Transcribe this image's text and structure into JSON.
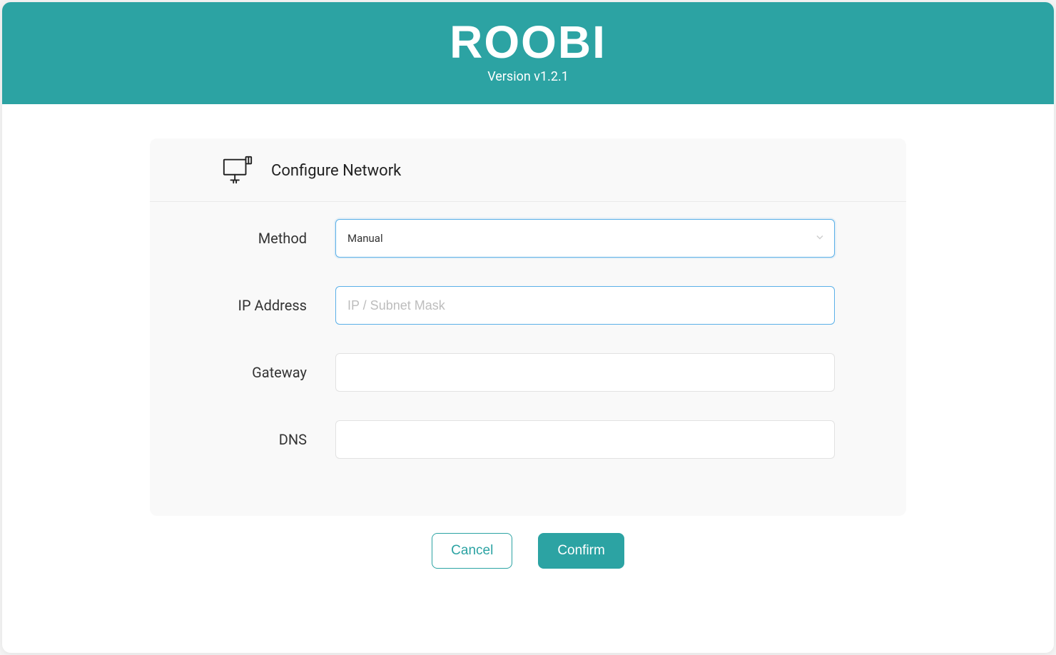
{
  "header": {
    "title": "ROOBI",
    "version": "Version v1.2.1"
  },
  "card": {
    "title": "Configure Network",
    "icon": "network-computer-icon"
  },
  "form": {
    "method": {
      "label": "Method",
      "selected": "Manual"
    },
    "ip": {
      "label": "IP Address",
      "placeholder": "IP / Subnet Mask",
      "value": ""
    },
    "gateway": {
      "label": "Gateway",
      "placeholder": "",
      "value": ""
    },
    "dns": {
      "label": "DNS",
      "placeholder": "",
      "value": ""
    }
  },
  "buttons": {
    "cancel": "Cancel",
    "confirm": "Confirm"
  }
}
